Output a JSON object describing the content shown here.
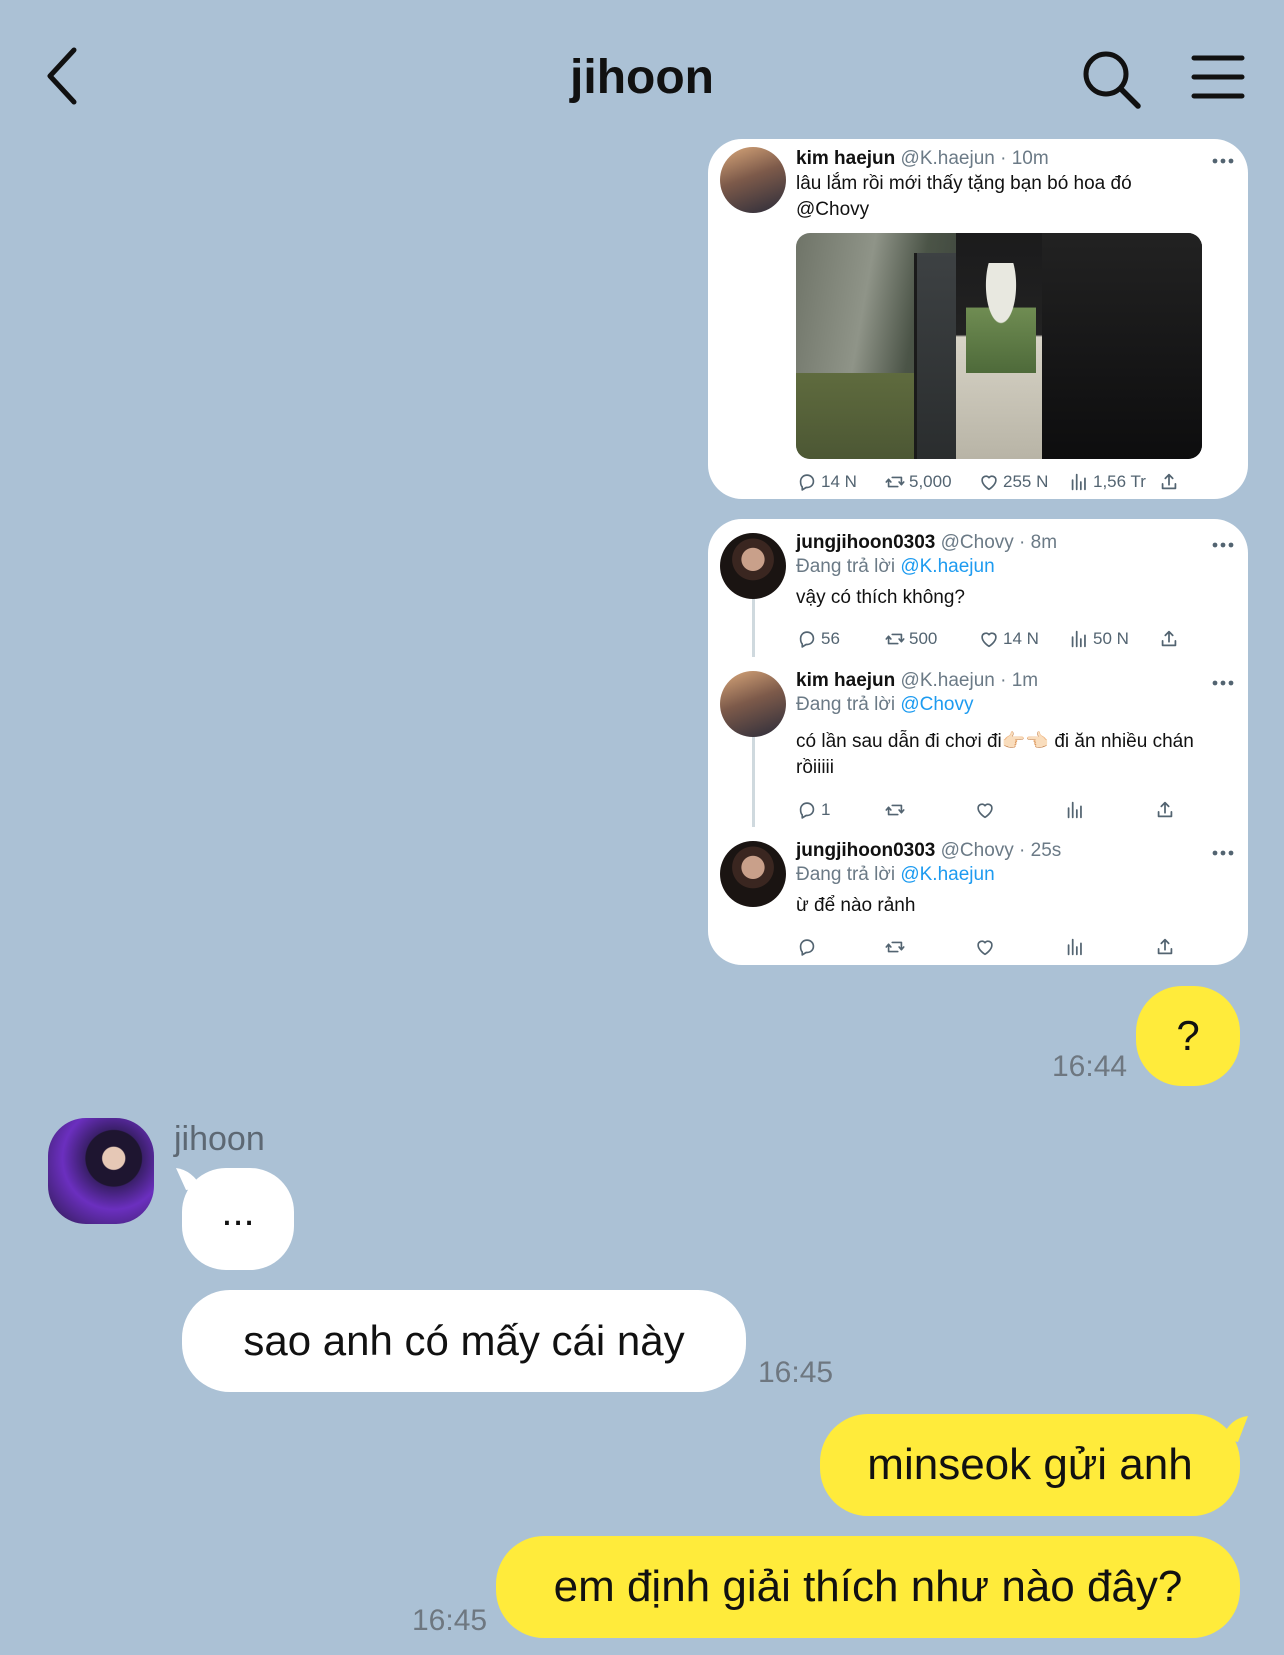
{
  "header": {
    "title": "jihoon"
  },
  "tweets": {
    "tweet1": {
      "name": "kim haejun",
      "handle": "@K.haejun · 10m",
      "text": "lâu lắm rồi mới thấy tặng bạn bó hoa đó",
      "mention": "@Chovy",
      "stats": {
        "replies": "14 N",
        "retweets": "5,000",
        "likes": "255 N",
        "views": "1,56 Tr"
      }
    },
    "tweet2": {
      "name": "jungjihoon0303",
      "handle": "@Chovy · 8m",
      "reply_prefix": "Đang trả lời",
      "reply_to": "@K.haejun",
      "text": "vậy có thích không?",
      "stats": {
        "replies": "56",
        "retweets": "500",
        "likes": "14 N",
        "views": "50 N"
      }
    },
    "tweet3": {
      "name": "kim haejun",
      "handle": "@K.haejun · 1m",
      "reply_prefix": "Đang trả lời",
      "reply_to": "@Chovy",
      "text_line1": "có lần sau dẫn đi chơi đi👉🏻👈🏻 đi ăn nhiều chán",
      "text_line2": "rồiiiii",
      "stats": {
        "replies": "1"
      }
    },
    "tweet4": {
      "name": "jungjihoon0303",
      "handle": "@Chovy · 25s",
      "reply_prefix": "Đang trả lời",
      "reply_to": "@K.haejun",
      "text": "ừ để nào rảnh"
    }
  },
  "messages": [
    {
      "side": "me",
      "text": "?",
      "time": "16:44"
    },
    {
      "side": "other",
      "sender": "jihoon",
      "text": "..."
    },
    {
      "side": "other",
      "text": "sao anh có mấy cái này",
      "time": "16:45"
    },
    {
      "side": "me",
      "text": "minseok gửi anh"
    },
    {
      "side": "me",
      "text": "em định giải thích như nào đây?",
      "time": "16:45"
    }
  ],
  "colors": {
    "background": "#abc1d5",
    "my_bubble": "#ffeb3b",
    "their_bubble": "#ffffff",
    "mention": "#1d9bf0"
  },
  "icons": [
    "back-arrow-icon",
    "search-icon",
    "menu-icon",
    "reply-icon",
    "retweet-icon",
    "like-icon",
    "views-icon",
    "share-icon",
    "more-icon"
  ]
}
